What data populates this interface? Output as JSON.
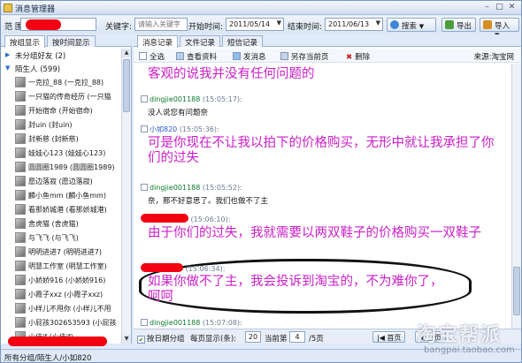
{
  "window": {
    "title": "消息管理器",
    "minimize": "–",
    "maximize": "□",
    "close": "✕"
  },
  "toolbar": {
    "scope_label": "范 围",
    "keyword_label": "关键字:",
    "keyword_placeholder": "请输入关键字",
    "start_label": "开始时间:",
    "start_date": "2011/05/14",
    "end_label": "结束时间:",
    "end_date": "2011/06/13",
    "search_button": "搜索",
    "export_button": "导出",
    "import_button": "导入"
  },
  "left_panel": {
    "tabs": [
      "按组显示",
      "按时间显示"
    ],
    "groups": [
      {
        "label": "未分组好友 (2)",
        "expanded": false
      },
      {
        "label": "陌生人 (599)",
        "expanded": true
      }
    ],
    "contacts": [
      "一克拉_88 (一克拉_88)",
      "一只猫的传奇经历 (一只猫",
      "开始宿命 (开始宿命)",
      "封uin (封uin)",
      "封新慈 (封新慈)",
      "娃娃心123 (娃娃心123)",
      "圆圆圈1989 (圆圆圈1989)",
      "愿边落寂 (愿边落寂)",
      "麟小鱼mm (麟小鱼mm)",
      "看那娇城港 (看那娇城港)",
      "舍虎猫 (舍虎猫)",
      "与飞飞 (与飞飞)",
      "明明进进7 (明明进进7)",
      "明慧工作室 (明慧工作室)",
      "小娇娇916 (小娇娇916)",
      "小霞子xxz (小霞子xxz)",
      "小样儿不甩你 (小样儿不甩",
      "小屁孩302653593 (小屁孩",
      "小佳jf (小佳jf)"
    ]
  },
  "right_panel": {
    "tabs": [
      "消息记录",
      "文件记录",
      "短信记录"
    ],
    "actions": {
      "select_all": "全选",
      "view_profile": "查看资料",
      "send_message": "发消息",
      "save_page": "另存当前页",
      "delete": "删除"
    },
    "source": "来源:淘宝网",
    "messages": [
      {
        "user": "",
        "time": "",
        "text": "客观的说我并没有任何问题的",
        "big": true
      },
      {
        "user": "dingjie001188",
        "time": "(15:05:17):",
        "text": "没人说您有问题奈",
        "big": false
      },
      {
        "user": "小如820",
        "time": "(15:05:36):",
        "text": "可是你现在不让我以拍下的价格购买，无形中就让我承担了你们的过失",
        "big": true
      },
      {
        "user": "dingjie001188",
        "time": "(15:05:52):",
        "text": "奈，那不好意思了。我们也做不了主",
        "big": false
      },
      {
        "user": "",
        "time": "(15:06:10):",
        "text": "由于你们的过失，我就需要以两双鞋子的价格购买一双鞋子",
        "big": true
      },
      {
        "user": "",
        "time": "(15:06:34):",
        "text": "如果你做不了主，我会投诉到淘宝的，不为难你了，呵呵",
        "big": true
      },
      {
        "user": "dingjie001188",
        "time": "(15:07:08):",
        "text": "",
        "big": false
      }
    ],
    "footer": {
      "group_by_date": "按日期分组",
      "per_page_label": "每页显示(条):",
      "per_page_value": "20",
      "current_label": "当前第",
      "current_value": "4",
      "total_pages": "/5页",
      "first_button": "首页",
      "prev_button": "上页"
    }
  },
  "status": "所有分组/陌生人/小如820",
  "watermark": {
    "logo": "淘宝帮派",
    "url": "bangpai.taobao.com"
  },
  "colors": {
    "accent": "#2d6fc1",
    "highlight_text": "#cb1fc8",
    "redaction": "#f20012"
  }
}
